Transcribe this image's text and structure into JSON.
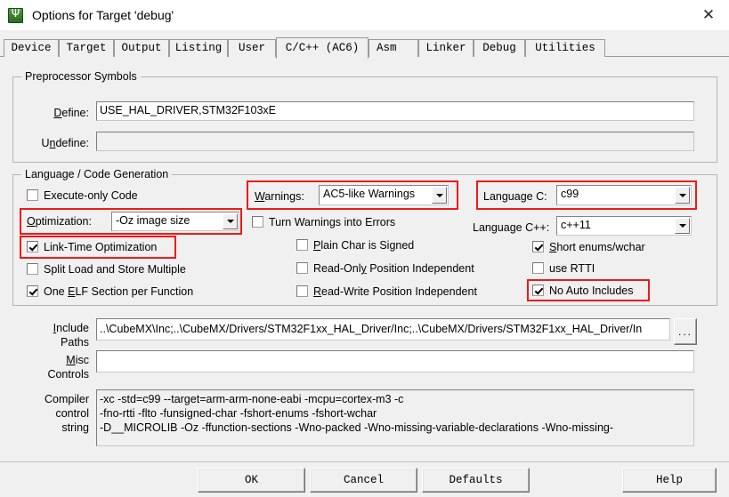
{
  "window": {
    "title": "Options for Target 'debug'",
    "icon": "uvision-icon",
    "close_label": "✕"
  },
  "tabs": [
    {
      "label": "Device",
      "active": false
    },
    {
      "label": "Target",
      "active": false
    },
    {
      "label": "Output",
      "active": false
    },
    {
      "label": "Listing",
      "active": false
    },
    {
      "label": "User",
      "active": false
    },
    {
      "label": "C/C++ (AC6)",
      "active": true
    },
    {
      "label": "Asm",
      "active": false
    },
    {
      "label": "Linker",
      "active": false
    },
    {
      "label": "Debug",
      "active": false
    },
    {
      "label": "Utilities",
      "active": false
    }
  ],
  "preprocessor": {
    "group_label": "Preprocessor Symbols",
    "define_label": "Define:",
    "define_value": "USE_HAL_DRIVER,STM32F103xE",
    "undefine_label": "Undefine:",
    "undefine_value": ""
  },
  "language": {
    "group_label": "Language / Code Generation",
    "execute_only_code": {
      "label": "Execute-only Code",
      "checked": false
    },
    "optimization": {
      "label": "Optimization:",
      "value": "-Oz image size"
    },
    "link_time_optimization": {
      "label": "Link-Time Optimization",
      "checked": true
    },
    "split_load_store": {
      "label": "Split Load and Store Multiple",
      "checked": false
    },
    "one_elf_section": {
      "label": "One ELF Section per Function",
      "checked": true
    },
    "warnings": {
      "label": "Warnings:",
      "value": "AC5-like Warnings"
    },
    "turn_warnings_into_errors": {
      "label": "Turn Warnings into Errors",
      "checked": false
    },
    "plain_char_signed": {
      "label": "Plain Char is Signed",
      "checked": false
    },
    "read_only_position_independent": {
      "label": "Read-Only Position Independent",
      "checked": false
    },
    "read_write_position_independent": {
      "label": "Read-Write Position Independent",
      "checked": false
    },
    "language_c": {
      "label": "Language C:",
      "value": "c99"
    },
    "language_cpp": {
      "label": "Language C++:",
      "value": "c++11"
    },
    "short_enums_wchar": {
      "label": "Short enums/wchar",
      "checked": true
    },
    "use_rtti": {
      "label": "use RTTI",
      "checked": false
    },
    "no_auto_includes": {
      "label": "No Auto Includes",
      "checked": true
    }
  },
  "paths": {
    "include_label_line1": "Include",
    "include_label_line2": "Paths",
    "include_value": "..\\CubeMX\\Inc;..\\CubeMX/Drivers/STM32F1xx_HAL_Driver/Inc;..\\CubeMX/Drivers/STM32F1xx_HAL_Driver/In",
    "browse_label": "...",
    "misc_label_line1": "Misc",
    "misc_label_line2": "Controls",
    "misc_value": ""
  },
  "compiler": {
    "label_line1": "Compiler",
    "label_line2": "control",
    "label_line3": "string",
    "value": "-xc -std=c99 --target=arm-arm-none-eabi -mcpu=cortex-m3 -c\n-fno-rtti -flto -funsigned-char -fshort-enums -fshort-wchar\n-D__MICROLIB -Oz -ffunction-sections -Wno-packed -Wno-missing-variable-declarations -Wno-missing-"
  },
  "buttons": {
    "ok": "OK",
    "cancel": "Cancel",
    "defaults": "Defaults",
    "help": "Help"
  },
  "annotations": {
    "color": "#ef1a16",
    "highlights": [
      "optimization-combo",
      "link-time-optimization-checkbox",
      "warnings-combo",
      "language-c-combo",
      "no-auto-includes-checkbox"
    ]
  }
}
